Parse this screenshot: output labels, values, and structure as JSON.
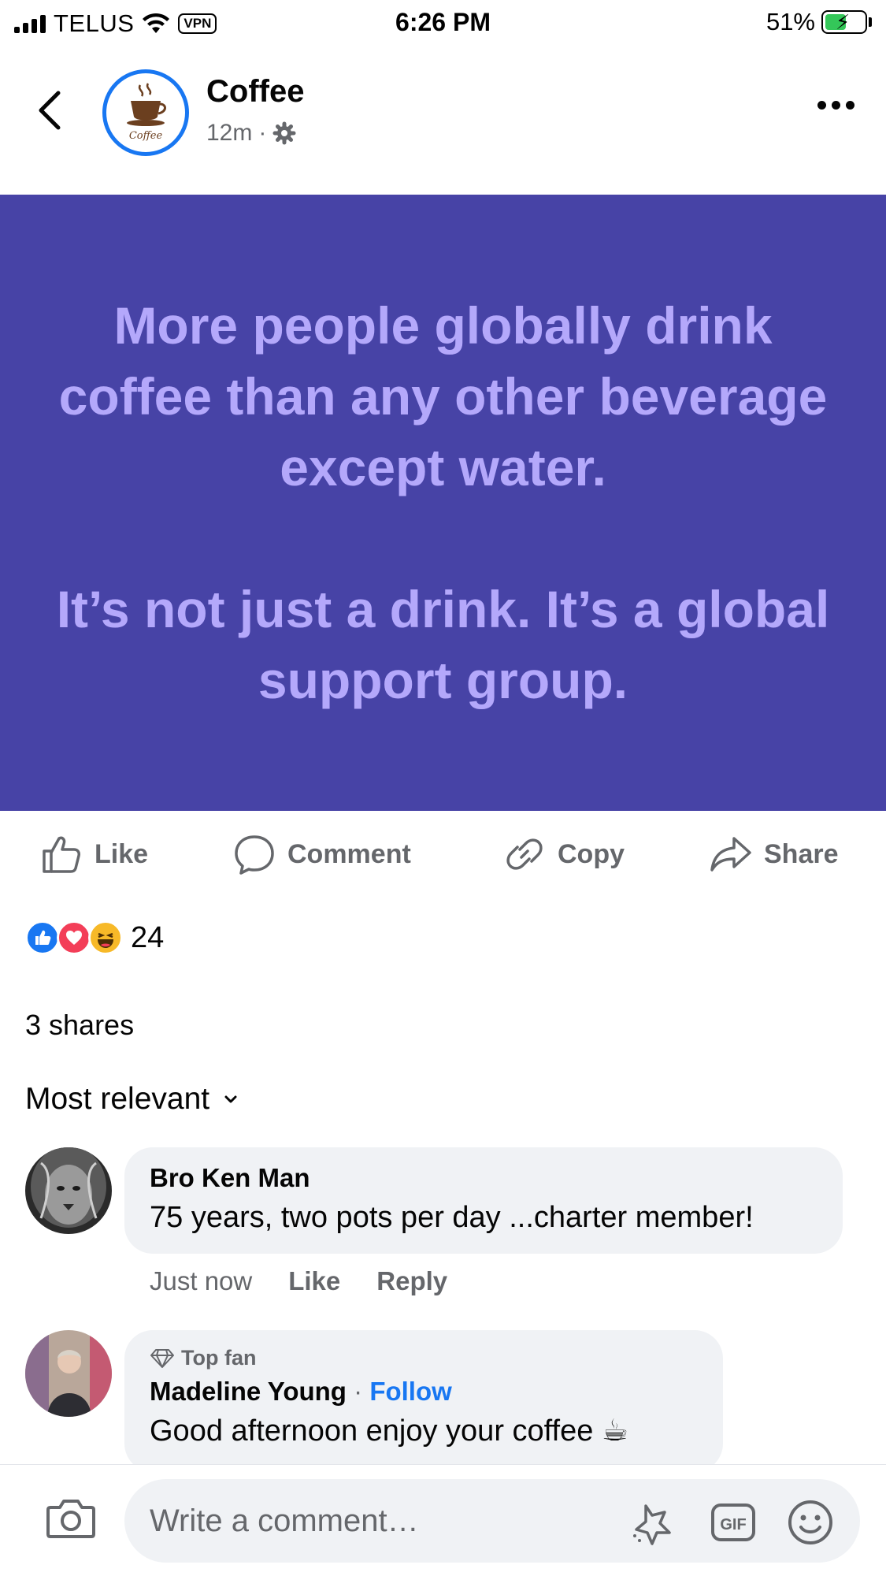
{
  "status_bar": {
    "carrier": "TELUS",
    "vpn": "VPN",
    "time": "6:26 PM",
    "battery": "51%"
  },
  "header": {
    "page_name": "Coffee",
    "timestamp": "12m",
    "separator": "·",
    "logo_text": "Coffee"
  },
  "post": {
    "paragraph1": "More people globally drink coffee than any other beverage except water.",
    "paragraph2": "It’s not just a drink. It’s a global support group.",
    "background_color": "#4743a6",
    "text_color": "#b4a8fb"
  },
  "actions": {
    "like": "Like",
    "comment": "Comment",
    "copy": "Copy",
    "share": "Share"
  },
  "engagement": {
    "reaction_count": "24",
    "shares": "3 shares",
    "sort_label": "Most relevant"
  },
  "comments": [
    {
      "author": "Bro Ken Man",
      "text": "75 years, two pots per day ...charter member!",
      "time": "Just now",
      "like": "Like",
      "reply": "Reply"
    },
    {
      "badge": "Top fan",
      "author": "Madeline Young",
      "separator": "·",
      "follow": "Follow",
      "text": "Good afternoon enjoy your coffee ☕"
    }
  ],
  "composer": {
    "placeholder": "Write a comment…"
  },
  "colors": {
    "accent": "#1877f2",
    "muted": "#65676b",
    "bubble": "#f0f2f5"
  }
}
